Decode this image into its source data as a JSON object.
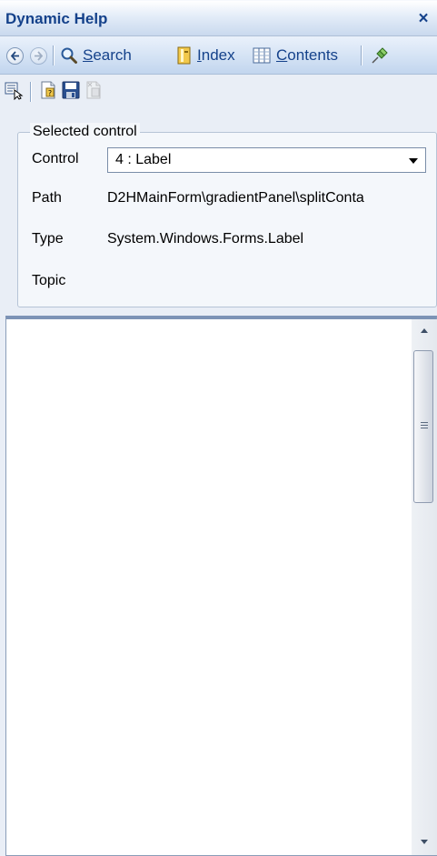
{
  "window": {
    "title": "Dynamic Help",
    "close_glyph": "×"
  },
  "nav_toolbar": {
    "back_icon": "back-arrow-icon",
    "forward_icon": "forward-arrow-icon",
    "search": {
      "label": "Search",
      "icon": "magnifier-icon"
    },
    "index": {
      "label": "Index",
      "icon": "index-book-icon"
    },
    "contents": {
      "label": "Contents",
      "icon": "contents-book-icon"
    },
    "pin_icon": "pin-icon"
  },
  "tools_toolbar": {
    "items": [
      "select-control-icon",
      "help-topic-icon",
      "save-icon",
      "disabled-topic-icon"
    ]
  },
  "selected_control": {
    "legend": "Selected control",
    "control_label": "Control",
    "control_value": "4 : Label",
    "path_label": "Path",
    "path_value": "D2HMainForm\\gradientPanel\\splitConta",
    "type_label": "Type",
    "type_value": "System.Windows.Forms.Label",
    "topic_label": "Topic",
    "topic_value": ""
  },
  "colors": {
    "title_text": "#15428b",
    "toolbar_gradient_top": "#eaf1fb",
    "toolbar_gradient_bottom": "#c2d5ee",
    "panel_background": "#e9eef6",
    "content_border": "#7c93b6"
  }
}
